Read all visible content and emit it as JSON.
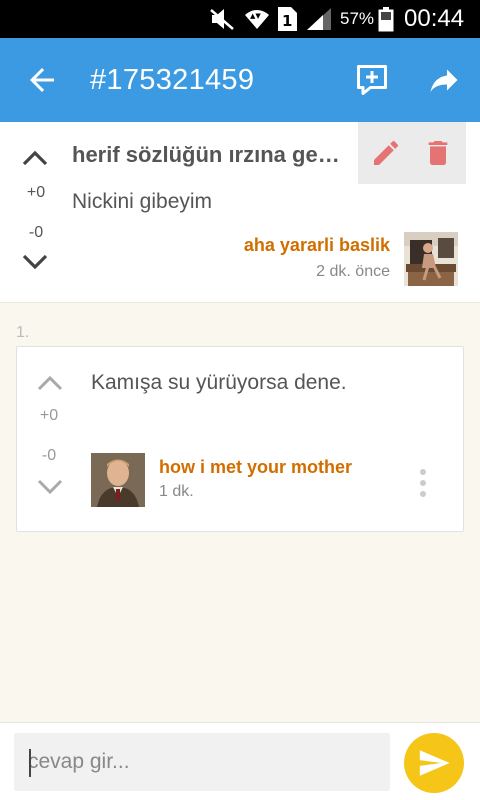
{
  "status_bar": {
    "battery_percent": "57%",
    "time": "00:44",
    "sim_slot": "1",
    "icons": [
      "mute-icon",
      "wifi-icon",
      "sim-icon",
      "signal-icon",
      "battery-icon"
    ]
  },
  "app_bar": {
    "title": "#175321459",
    "icons": [
      "back-arrow-icon",
      "new-comment-icon",
      "share-icon"
    ]
  },
  "entry": {
    "topic": "herif sözlüğün ırzına geçmiş",
    "text": "Nickini gibeyim",
    "up_count": "+0",
    "down_count": "-0",
    "author": "aha yararli baslik",
    "time": "2 dk. önce",
    "action_icons": [
      "pencil-icon",
      "trash-icon"
    ]
  },
  "replies": [
    {
      "index": "1.",
      "text": "Kamışa su yürüyorsa dene.",
      "up_count": "+0",
      "down_count": "-0",
      "author": "how i met your mother",
      "time": "1 dk."
    }
  ],
  "composer": {
    "placeholder": "cevap gir...",
    "value": ""
  },
  "colors": {
    "app_bar": "#3b9ae1",
    "author": "#d26e00",
    "send_button": "#f5c518",
    "delete": "#e57373"
  }
}
